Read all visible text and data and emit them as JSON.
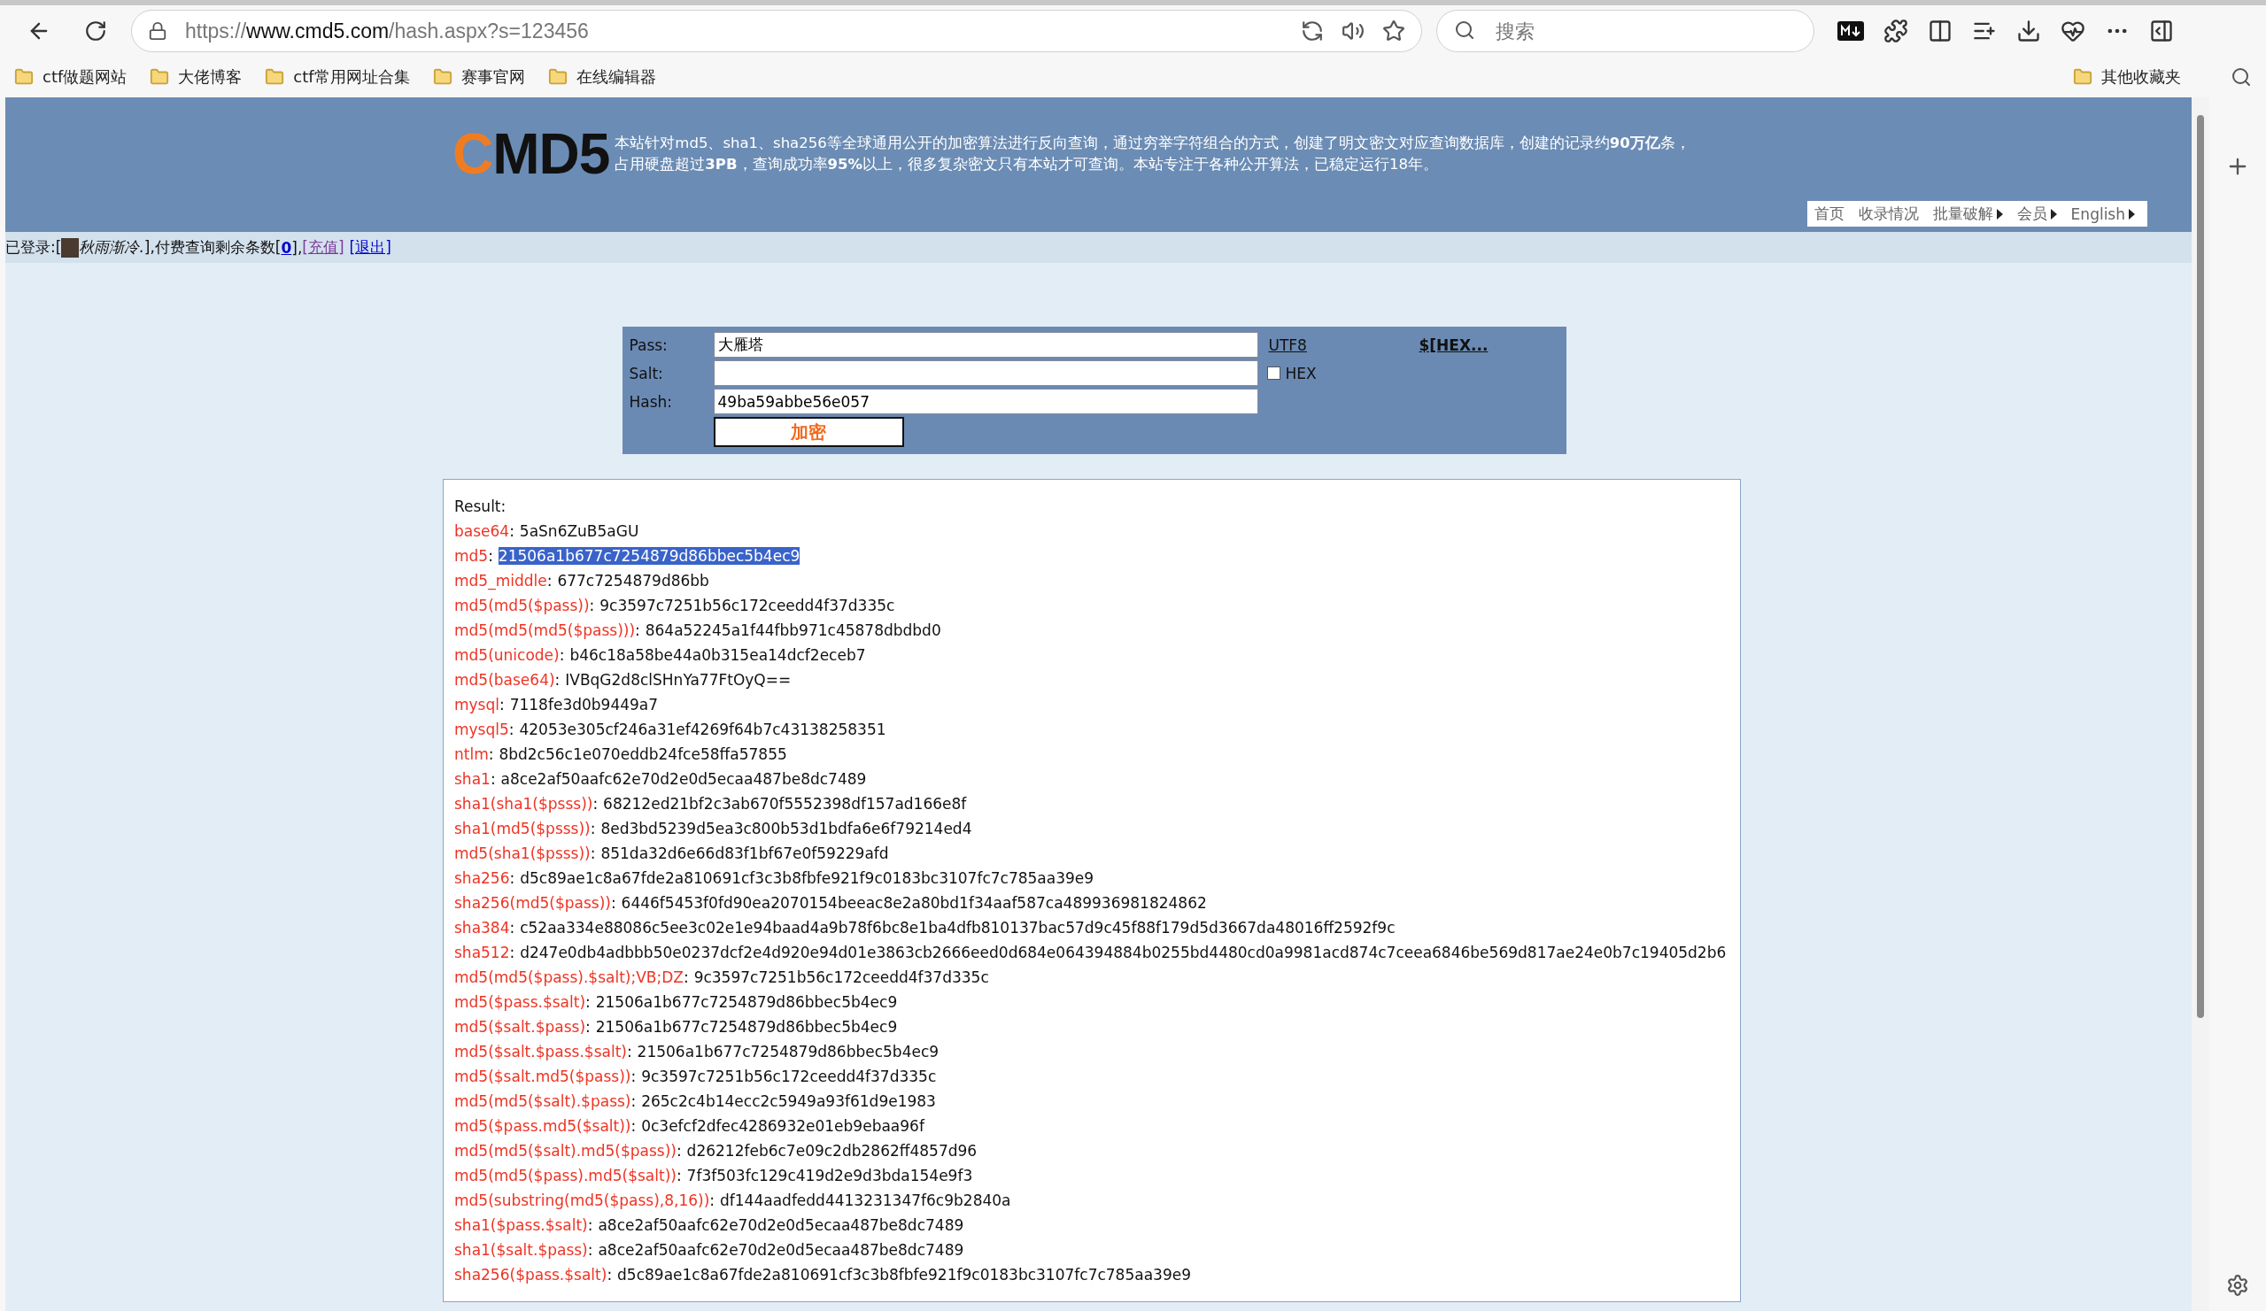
{
  "browser": {
    "url_scheme": "https://",
    "url_host": "www.cmd5.com",
    "url_path": "/hash.aspx?s=123456",
    "search_placeholder": "搜索",
    "bookmarks": [
      "ctf做题网站",
      "大佬博客",
      "ctf常用网址合集",
      "赛事官网",
      "在线编辑器"
    ],
    "other_bookmarks": "其他收藏夹"
  },
  "header": {
    "logo_first": "C",
    "logo_rest": "MD5",
    "description": [
      "本站针对md5、sha1、sha256等全球通用公开的加密算法进行反向查询，通过穷举字符组合的方式，创建了明文密文对应查询数据库，创建的记录约**90万亿**条，",
      "占用硬盘超过**3PB**，查询成功率**95%**以上，很多复杂密文只有本站才可查询。本站专注于各种公开算法，已稳定运行18年。"
    ],
    "nav": [
      {
        "label": "首页",
        "has_submenu": false
      },
      {
        "label": "收录情况",
        "has_submenu": false
      },
      {
        "label": "批量破解",
        "has_submenu": true
      },
      {
        "label": "会员",
        "has_submenu": true
      },
      {
        "label": "English",
        "has_submenu": true
      }
    ]
  },
  "login": {
    "prefix": "已登录:[",
    "user": "秋雨渐冷.",
    "middle": "],付费查询剩余条数[",
    "count": "0",
    "suffix": "],",
    "recharge": "[充值]",
    "logout": "[退出]"
  },
  "form": {
    "pass_label": "Pass:",
    "pass_value": "大雁塔",
    "salt_label": "Salt:",
    "hash_label": "Hash:",
    "hash_value": "49ba59abbe56e057",
    "utf8_link": "UTF8",
    "hex_link": "$[HEX...",
    "hex_checkbox": {
      "label": "HEX",
      "checked": false
    },
    "submit": "加密"
  },
  "result": {
    "title": "Result:",
    "separator": ":",
    "rows": [
      {
        "key": "base64",
        "value": "5aSn6ZuB5aGU",
        "selected": false
      },
      {
        "key": "md5",
        "value": "21506a1b677c7254879d86bbec5b4ec9",
        "selected": true
      },
      {
        "key": "md5_middle",
        "value": "677c7254879d86bb",
        "selected": false
      },
      {
        "key": "md5(md5($pass))",
        "value": "9c3597c7251b56c172ceedd4f37d335c",
        "selected": false
      },
      {
        "key": "md5(md5(md5($pass)))",
        "value": "864a52245a1f44fbb971c45878dbdbd0",
        "selected": false
      },
      {
        "key": "md5(unicode)",
        "value": "b46c18a58be44a0b315ea14dcf2eceb7",
        "selected": false
      },
      {
        "key": "md5(base64)",
        "value": "IVBqG2d8clSHnYa77FtOyQ==",
        "selected": false
      },
      {
        "key": "mysql",
        "value": "7118fe3d0b9449a7",
        "selected": false
      },
      {
        "key": "mysql5",
        "value": "42053e305cf246a31ef4269f64b7c43138258351",
        "selected": false
      },
      {
        "key": "ntlm",
        "value": "8bd2c56c1e070eddb24fce58ffa57855",
        "selected": false
      },
      {
        "key": "sha1",
        "value": "a8ce2af50aafc62e70d2e0d5ecaa487be8dc7489",
        "selected": false
      },
      {
        "key": "sha1(sha1($psss))",
        "value": "68212ed21bf2c3ab670f5552398df157ad166e8f",
        "selected": false
      },
      {
        "key": "sha1(md5($psss))",
        "value": "8ed3bd5239d5ea3c800b53d1bdfa6e6f79214ed4",
        "selected": false
      },
      {
        "key": "md5(sha1($psss))",
        "value": "851da32d6e66d83f1bf67e0f59229afd",
        "selected": false
      },
      {
        "key": "sha256",
        "value": "d5c89ae1c8a67fde2a810691cf3c3b8fbfe921f9c0183bc3107fc7c785aa39e9",
        "selected": false
      },
      {
        "key": "sha256(md5($pass))",
        "value": "6446f5453f0fd90ea2070154beeac8e2a80bd1f34aaf587ca489936981824862",
        "selected": false
      },
      {
        "key": "sha384",
        "value": "c52aa334e88086c5ee3c02e1e94baad4a9b78f6bc8e1ba4dfb810137bac57d9c45f88f179d5d3667da48016ff2592f9c",
        "selected": false
      },
      {
        "key": "sha512",
        "value": "d247e0db4adbbb50e0237dcf2e4d920e94d01e3863cb2666eed0d684e064394884b0255bd4480cd0a9981acd874c7ceea6846be569d817ae24e0b7c19405d2b6",
        "selected": false
      },
      {
        "key": "md5(md5($pass).$salt);VB;DZ",
        "value": "9c3597c7251b56c172ceedd4f37d335c",
        "selected": false
      },
      {
        "key": "md5($pass.$salt)",
        "value": "21506a1b677c7254879d86bbec5b4ec9",
        "selected": false
      },
      {
        "key": "md5($salt.$pass)",
        "value": "21506a1b677c7254879d86bbec5b4ec9",
        "selected": false
      },
      {
        "key": "md5($salt.$pass.$salt)",
        "value": "21506a1b677c7254879d86bbec5b4ec9",
        "selected": false
      },
      {
        "key": "md5($salt.md5($pass))",
        "value": "9c3597c7251b56c172ceedd4f37d335c",
        "selected": false
      },
      {
        "key": "md5(md5($salt).$pass)",
        "value": "265c2c4b14ecc2c5949a93f61d9e1983",
        "selected": false
      },
      {
        "key": "md5($pass.md5($salt))",
        "value": "0c3efcf2dfec4286932e01eb9ebaa96f",
        "selected": false
      },
      {
        "key": "md5(md5($salt).md5($pass))",
        "value": "d26212feb6c7e09c2db2862ff4857d96",
        "selected": false
      },
      {
        "key": "md5(md5($pass).md5($salt))",
        "value": "7f3f503fc129c419d2e9d3bda154e9f3",
        "selected": false
      },
      {
        "key": "md5(substring(md5($pass),8,16))",
        "value": "df144aadfedd4413231347f6c9b2840a",
        "selected": false
      },
      {
        "key": "sha1($pass.$salt)",
        "value": "a8ce2af50aafc62e70d2e0d5ecaa487be8dc7489",
        "selected": false
      },
      {
        "key": "sha1($salt.$pass)",
        "value": "a8ce2af50aafc62e70d2e0d5ecaa487be8dc7489",
        "selected": false
      },
      {
        "key": "sha256($pass.$salt)",
        "value": "d5c89ae1c8a67fde2a810691cf3c3b8fbfe921f9c0183bc3107fc7c785aa39e9",
        "selected": false
      }
    ]
  }
}
